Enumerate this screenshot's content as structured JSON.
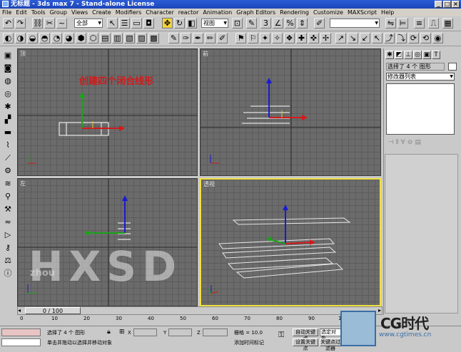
{
  "title": {
    "text": "无标题 - 3ds max 7 - Stand-alone License"
  },
  "menu": [
    "File",
    "Edit",
    "Tools",
    "Group",
    "Views",
    "Create",
    "Modifiers",
    "Character",
    "reactor",
    "Animation",
    "Graph Editors",
    "Rendering",
    "Customize",
    "MAXScript",
    "Help"
  ],
  "toolbar": {
    "selection_filter": "全部",
    "ref_coord": "视图"
  },
  "viewports": {
    "top": {
      "label": "顶",
      "annotation": "创建四个闭合线形"
    },
    "front": {
      "label": "前"
    },
    "left": {
      "label": "左"
    },
    "perspective": {
      "label": "透视"
    }
  },
  "watermark": {
    "main": "HXSD",
    "sub": "zhou"
  },
  "command_panel": {
    "name_field": "选择了 4 个 图形",
    "modifier_list": "修改器列表"
  },
  "timeline": {
    "frame": "0 / 100",
    "ticks": [
      "0",
      "10",
      "20",
      "30",
      "40",
      "50",
      "60",
      "70",
      "80",
      "90",
      "100"
    ]
  },
  "status": {
    "selection": "选择了 4 个 图形",
    "prompt": "单击并拖动以选择并移动对象",
    "x_label": "X",
    "y_label": "Y",
    "z_label": "Z",
    "grid": "栅格 = 10.0",
    "add_time_tag": "添加时间标记",
    "auto_key": "自动关键点",
    "set_key": "设置关键点",
    "selected_object": "选定对象",
    "key_filters": "关键点过滤器"
  },
  "logo": {
    "text": "CG时代",
    "url": "www.cgtimes.cn"
  },
  "colors": {
    "accent": "#f0e040",
    "selection_white": "#ffffff"
  }
}
